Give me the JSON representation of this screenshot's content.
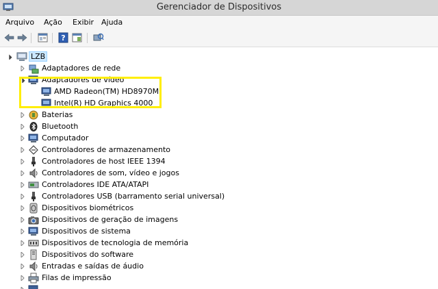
{
  "window": {
    "title": "Gerenciador de Dispositivos",
    "app_icon": "device-manager-icon"
  },
  "menu": [
    {
      "label": "Arquivo"
    },
    {
      "label": "Ação"
    },
    {
      "label": "Exibir"
    },
    {
      "label": "Ajuda"
    }
  ],
  "toolbar": {
    "buttons": [
      "back-arrow-icon",
      "forward-arrow-icon",
      "properties-icon",
      "help-icon",
      "show-hidden-icon",
      "scan-hardware-icon"
    ]
  },
  "tree": {
    "root": {
      "label": "LZB",
      "icon": "computer-icon",
      "expanded": true
    },
    "categories": [
      {
        "label": "Adaptadores de rede",
        "icon": "network-adapter-icon",
        "expanded": false
      },
      {
        "label": "Adaptadores de vídeo",
        "icon": "display-adapter-icon",
        "expanded": true,
        "children": [
          {
            "label": "AMD Radeon(TM) HD8970M",
            "icon": "display-adapter-icon"
          },
          {
            "label": "Intel(R) HD Graphics 4000",
            "icon": "display-adapter-icon"
          }
        ]
      },
      {
        "label": "Baterias",
        "icon": "battery-icon",
        "expanded": false
      },
      {
        "label": "Bluetooth",
        "icon": "bluetooth-icon",
        "expanded": false
      },
      {
        "label": "Computador",
        "icon": "computer-icon",
        "expanded": false
      },
      {
        "label": "Controladores de armazenamento",
        "icon": "storage-controller-icon",
        "expanded": false
      },
      {
        "label": "Controladores de host IEEE 1394",
        "icon": "ieee1394-icon",
        "expanded": false
      },
      {
        "label": "Controladores de som, vídeo e jogos",
        "icon": "speaker-icon",
        "expanded": false
      },
      {
        "label": "Controladores IDE ATA/ATAPI",
        "icon": "ide-controller-icon",
        "expanded": false
      },
      {
        "label": "Controladores USB (barramento serial universal)",
        "icon": "usb-icon",
        "expanded": false
      },
      {
        "label": "Dispositivos biométricos",
        "icon": "biometric-icon",
        "expanded": false
      },
      {
        "label": "Dispositivos de geração de imagens",
        "icon": "imaging-device-icon",
        "expanded": false
      },
      {
        "label": "Dispositivos de sistema",
        "icon": "system-device-icon",
        "expanded": false
      },
      {
        "label": "Dispositivos de tecnologia de memória",
        "icon": "memory-device-icon",
        "expanded": false
      },
      {
        "label": "Dispositivos do software",
        "icon": "software-device-icon",
        "expanded": false
      },
      {
        "label": "Entradas e saídas de áudio",
        "icon": "audio-io-icon",
        "expanded": false
      },
      {
        "label": "Filas de impressão",
        "icon": "printer-icon",
        "expanded": false
      }
    ]
  },
  "highlight_color": "#ffee00"
}
